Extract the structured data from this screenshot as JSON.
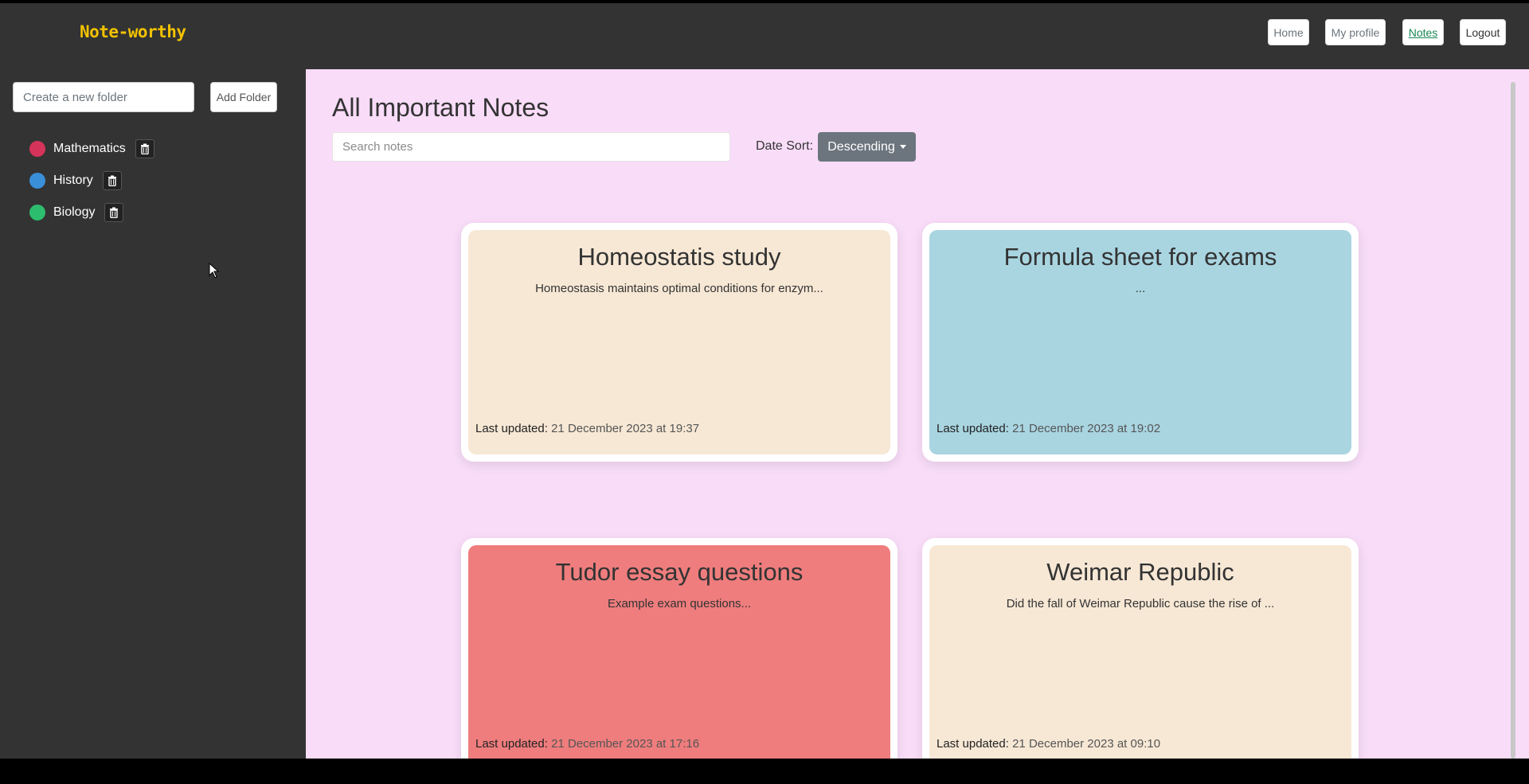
{
  "header": {
    "logo": "Note-worthy",
    "nav": [
      {
        "label": "Home"
      },
      {
        "label": "My profile"
      },
      {
        "label": "Notes"
      },
      {
        "label": "Logout"
      }
    ]
  },
  "sidebar": {
    "folder_placeholder": "Create a new folder",
    "add_folder_label": "Add Folder",
    "folders": [
      {
        "name": "Mathematics",
        "color": "#d6335a",
        "icon": "trash-icon"
      },
      {
        "name": "History",
        "color": "#3a8fd9",
        "icon": "trash-icon"
      },
      {
        "name": "Biology",
        "color": "#2dbd6e",
        "icon": "trash-icon"
      }
    ]
  },
  "main": {
    "title": "All Important Notes",
    "search_placeholder": "Search notes",
    "sort_label": "Date Sort:",
    "sort_value": "Descending"
  },
  "notes": [
    {
      "title": "Homeostatis study",
      "excerpt": "Homeostasis maintains optimal conditions for enzym...",
      "updated_label": "Last updated:",
      "updated_value": "21 December 2023 at 19:37",
      "color": "#f7e8d5"
    },
    {
      "title": "Formula sheet for exams",
      "excerpt": "...",
      "updated_label": "Last updated:",
      "updated_value": "21 December 2023 at 19:02",
      "color": "#a9d5e1"
    },
    {
      "title": "Tudor essay questions",
      "excerpt": "Example exam questions...",
      "updated_label": "Last updated:",
      "updated_value": "21 December 2023 at 17:16",
      "color": "#ef7d7d"
    },
    {
      "title": "Weimar Republic",
      "excerpt": "Did the fall of Weimar Republic cause the rise of ...",
      "updated_label": "Last updated:",
      "updated_value": "21 December 2023 at 09:10",
      "color": "#f7e8d5"
    }
  ]
}
